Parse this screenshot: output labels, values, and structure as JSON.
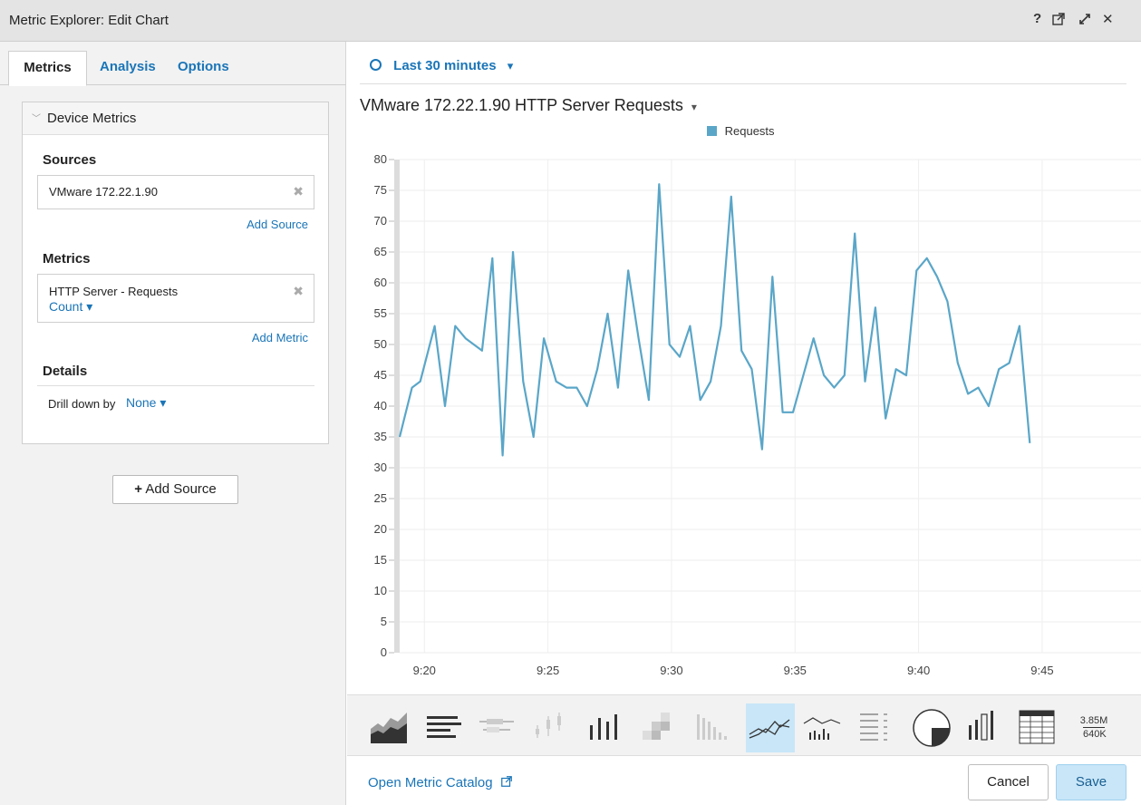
{
  "window": {
    "title": "Metric Explorer: Edit Chart",
    "help_glyph": "?",
    "close_glyph": "✕"
  },
  "tabs": [
    {
      "label": "Metrics",
      "active": true
    },
    {
      "label": "Analysis",
      "active": false
    },
    {
      "label": "Options",
      "active": false
    }
  ],
  "device_metrics": {
    "header": "Device Metrics",
    "sources_label": "Sources",
    "source_value": "VMware 172.22.1.90",
    "add_source_link": "Add Source",
    "metrics_label": "Metrics",
    "metric_name": "HTTP Server - Requests",
    "metric_agg": "Count ▾",
    "add_metric_link": "Add Metric",
    "details_label": "Details",
    "drill_label": "Drill down by",
    "drill_value": "None ▾"
  },
  "add_source_button": "Add Source",
  "add_source_plus": "+",
  "time_range": "Last 30 minutes",
  "time_caret": "▾",
  "chart_title": "VMware 172.22.1.90 HTTP Server Requests",
  "chart_title_caret": "▾",
  "chart_data": {
    "type": "line",
    "title": "VMware 172.22.1.90 HTTP Server Requests",
    "xlabel": "",
    "ylabel": "",
    "legend": "top-center",
    "grid": true,
    "ylim": [
      0,
      80
    ],
    "yticks": [
      0,
      5,
      10,
      15,
      20,
      25,
      30,
      35,
      40,
      45,
      50,
      55,
      60,
      65,
      70,
      75,
      80
    ],
    "xlim": [
      "9:19",
      "9:49"
    ],
    "xticks": [
      "9:20",
      "9:25",
      "9:30",
      "9:35",
      "9:40",
      "9:45"
    ],
    "series": [
      {
        "name": "Requests",
        "color": "#5aa6c8",
        "points": [
          [
            "9:19:00",
            35
          ],
          [
            "9:19:30",
            43
          ],
          [
            "9:19:50",
            44
          ],
          [
            "9:20:25",
            53
          ],
          [
            "9:20:50",
            40
          ],
          [
            "9:21:15",
            53
          ],
          [
            "9:21:40",
            51
          ],
          [
            "9:22:20",
            49
          ],
          [
            "9:22:45",
            64
          ],
          [
            "9:23:10",
            32
          ],
          [
            "9:23:35",
            65
          ],
          [
            "9:24:00",
            44
          ],
          [
            "9:24:25",
            35
          ],
          [
            "9:24:50",
            51
          ],
          [
            "9:25:20",
            44
          ],
          [
            "9:25:45",
            43
          ],
          [
            "9:26:10",
            43
          ],
          [
            "9:26:35",
            40
          ],
          [
            "9:27:00",
            46
          ],
          [
            "9:27:25",
            55
          ],
          [
            "9:27:50",
            43
          ],
          [
            "9:28:15",
            62
          ],
          [
            "9:28:40",
            51
          ],
          [
            "9:29:05",
            41
          ],
          [
            "9:29:30",
            76
          ],
          [
            "9:29:55",
            50
          ],
          [
            "9:30:20",
            48
          ],
          [
            "9:30:45",
            53
          ],
          [
            "9:31:10",
            41
          ],
          [
            "9:31:35",
            44
          ],
          [
            "9:32:00",
            53
          ],
          [
            "9:32:25",
            74
          ],
          [
            "9:32:50",
            49
          ],
          [
            "9:33:15",
            46
          ],
          [
            "9:33:40",
            33
          ],
          [
            "9:34:05",
            61
          ],
          [
            "9:34:30",
            39
          ],
          [
            "9:34:55",
            39
          ],
          [
            "9:35:20",
            45
          ],
          [
            "9:35:45",
            51
          ],
          [
            "9:36:10",
            45
          ],
          [
            "9:36:35",
            43
          ],
          [
            "9:37:00",
            45
          ],
          [
            "9:37:25",
            68
          ],
          [
            "9:37:50",
            44
          ],
          [
            "9:38:15",
            56
          ],
          [
            "9:38:40",
            38
          ],
          [
            "9:39:05",
            46
          ],
          [
            "9:39:30",
            45
          ],
          [
            "9:39:55",
            62
          ],
          [
            "9:40:20",
            64
          ],
          [
            "9:40:45",
            61
          ],
          [
            "9:41:10",
            57
          ],
          [
            "9:41:35",
            47
          ],
          [
            "9:42:00",
            42
          ],
          [
            "9:42:25",
            43
          ],
          [
            "9:42:50",
            40
          ],
          [
            "9:43:15",
            46
          ],
          [
            "9:43:40",
            47
          ],
          [
            "9:44:05",
            53
          ],
          [
            "9:44:30",
            34
          ]
        ]
      }
    ]
  },
  "chart_types": [
    {
      "name": "area",
      "selected": false
    },
    {
      "name": "bar-horizontal",
      "selected": false
    },
    {
      "name": "box-plot",
      "selected": false
    },
    {
      "name": "candlestick",
      "selected": false
    },
    {
      "name": "column",
      "selected": false
    },
    {
      "name": "heatmap",
      "selected": false
    },
    {
      "name": "histogram",
      "selected": false
    },
    {
      "name": "line",
      "selected": true
    },
    {
      "name": "line-and-bar",
      "selected": false
    },
    {
      "name": "list",
      "selected": false
    },
    {
      "name": "pie",
      "selected": false
    },
    {
      "name": "status",
      "selected": false
    },
    {
      "name": "table",
      "selected": false
    },
    {
      "name": "value",
      "selected": false,
      "labels": [
        "3.85M",
        "640K"
      ]
    }
  ],
  "footer": {
    "open_catalog": "Open Metric Catalog",
    "cancel": "Cancel",
    "save": "Save"
  }
}
